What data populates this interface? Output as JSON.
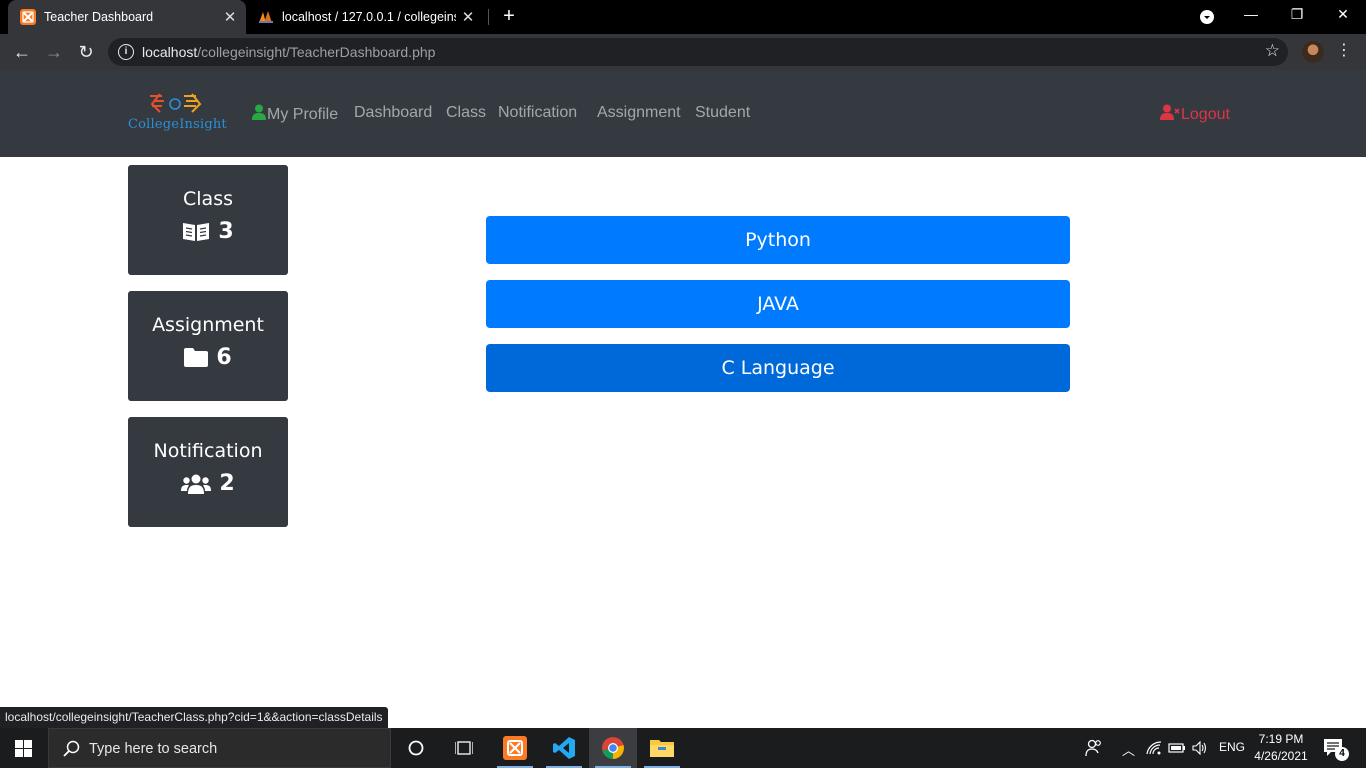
{
  "browser": {
    "tabs": [
      {
        "title": "Teacher Dashboard",
        "icon": "xampp-icon",
        "active": true
      },
      {
        "title": "localhost / 127.0.0.1 / collegeinsight",
        "icon": "phpmyadmin-icon",
        "active": false
      }
    ],
    "new_tab": "+",
    "url_host": "localhost",
    "url_path": "/collegeinsight/TeacherDashboard.php",
    "status_link": "localhost/collegeinsight/TeacherClass.php?cid=1&&action=classDetails"
  },
  "navbar": {
    "logo_text": "CollegeInsight",
    "links": [
      {
        "label": "My Profile",
        "icon": "user-icon"
      },
      {
        "label": "Dashboard"
      },
      {
        "label": "Class"
      },
      {
        "label": "Notification"
      },
      {
        "label": "Assignment"
      },
      {
        "label": "Student"
      }
    ],
    "logout_label": "Logout",
    "colors": {
      "bg": "#343a40",
      "link": "rgba(255,255,255,0.55)",
      "logout": "#dc3545",
      "profile_icon": "#28a745"
    }
  },
  "cards": [
    {
      "label": "Class",
      "icon": "book-reader-icon",
      "count": "3"
    },
    {
      "label": "Assignment",
      "icon": "folder-icon",
      "count": "6"
    },
    {
      "label": "Notification",
      "icon": "users-icon",
      "count": "2"
    }
  ],
  "classes": [
    {
      "name": "Python"
    },
    {
      "name": "JAVA"
    },
    {
      "name": "C Language"
    }
  ],
  "accent_color": "#007bff",
  "taskbar": {
    "search_placeholder": "Type here to search",
    "lang": "ENG",
    "time": "7:19 PM",
    "date": "4/26/2021",
    "notification_count": "4"
  }
}
